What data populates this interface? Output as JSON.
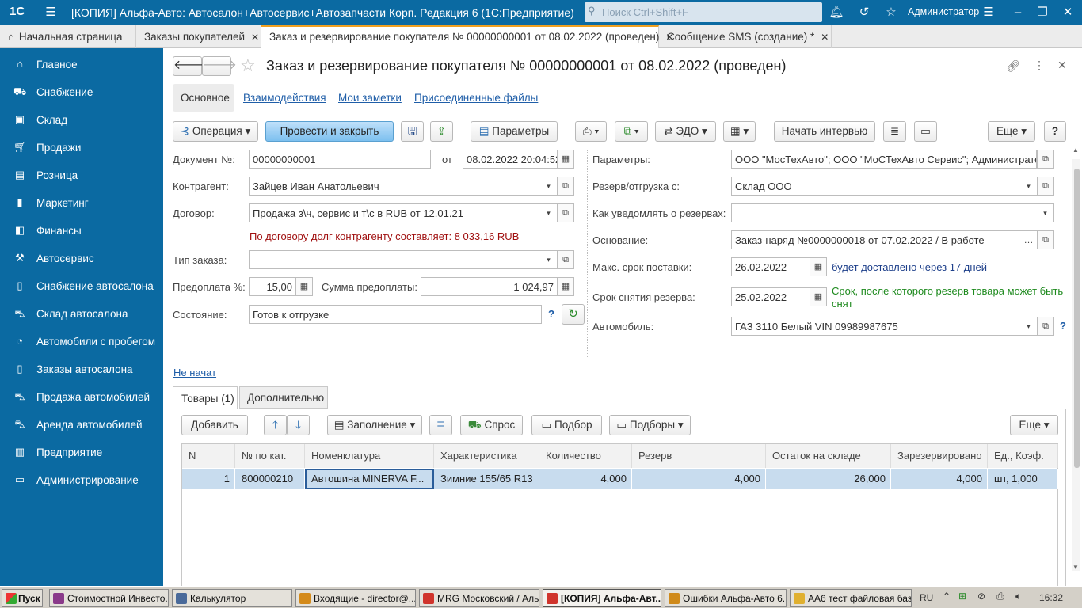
{
  "window": {
    "logo": "1С",
    "title": "[КОПИЯ] Альфа-Авто: Автосалон+Автосервис+Автозапчасти Корп. Редакция 6  (1С:Предприятие)",
    "search_placeholder": "Поиск Ctrl+Shift+F",
    "user": "Администратор"
  },
  "tabs": [
    {
      "label": "Начальная страница"
    },
    {
      "label": "Заказы покупателей"
    },
    {
      "label": "Заказ и резервирование покупателя № 00000000001 от 08.02.2022 (проведен)"
    },
    {
      "label": "Сообщение SMS (создание) *"
    }
  ],
  "sidebar": [
    {
      "label": "Главное",
      "icon": "home-icon"
    },
    {
      "label": "Снабжение",
      "icon": "truck-icon"
    },
    {
      "label": "Склад",
      "icon": "warehouse-icon"
    },
    {
      "label": "Продажи",
      "icon": "cart-icon"
    },
    {
      "label": "Розница",
      "icon": "store-icon"
    },
    {
      "label": "Маркетинг",
      "icon": "chart-icon"
    },
    {
      "label": "Финансы",
      "icon": "finance-icon"
    },
    {
      "label": "Автосервис",
      "icon": "wrench-icon"
    },
    {
      "label": "Снабжение автосалона",
      "icon": "doc-icon"
    },
    {
      "label": "Склад автосалона",
      "icon": "car-icon"
    },
    {
      "label": "Автомобили с пробегом",
      "icon": "speedometer-icon"
    },
    {
      "label": "Заказы автосалона",
      "icon": "doc-icon"
    },
    {
      "label": "Продажа автомобилей",
      "icon": "car-icon"
    },
    {
      "label": "Аренда автомобилей",
      "icon": "car-icon"
    },
    {
      "label": "Предприятие",
      "icon": "building-icon"
    },
    {
      "label": "Администрирование",
      "icon": "monitor-icon"
    }
  ],
  "doc": {
    "title": "Заказ и резервирование покупателя № 00000000001 от 08.02.2022 (проведен)",
    "subtabs": [
      "Основное",
      "Взаимодействия",
      "Мои заметки",
      "Присоединенные файлы"
    ],
    "toolbar": {
      "operation": "Операция",
      "post_close": "Провести и закрыть",
      "params": "Параметры",
      "edo": "ЭДО",
      "interview": "Начать интервью",
      "more": "Еще",
      "help": "?"
    },
    "fields": {
      "doc_no_label": "Документ №:",
      "doc_no": "00000000001",
      "from_label": "от",
      "date": "08.02.2022 20:04:52",
      "contractor_label": "Контрагент:",
      "contractor": "Зайцев Иван Анатольевич",
      "contract_label": "Договор:",
      "contract": "Продажа з\\ч, сервис и т\\с в RUB от 12.01.21",
      "debt_link": "По договору долг контрагенту составляет: 8 033,16 RUB",
      "order_type_label": "Тип заказа:",
      "order_type": "",
      "prepay_pct_label": "Предоплата %:",
      "prepay_pct": "15,00",
      "prepay_sum_label": "Сумма предоплаты:",
      "prepay_sum": "1 024,97",
      "state_label": "Состояние:",
      "state": "Готов к отгрузке",
      "state_help": "?",
      "params_label": "Параметры:",
      "params": "ООО \"МосТехАвто\"; ООО \"МоСТехАвто Сервис\"; Администратор",
      "reserve_from_label": "Резерв/отгрузка с:",
      "reserve_from": "Склад ООО",
      "notify_label": "Как уведомлять о резервах:",
      "notify": "",
      "basis_label": "Основание:",
      "basis": "Заказ-наряд №0000000018  от 07.02.2022 / В работе",
      "max_delivery_label": "Макс. срок поставки:",
      "max_delivery": "26.02.2022",
      "delivery_note": "будет доставлено через 17 дней",
      "reserve_removal_label": "Срок снятия резерва:",
      "reserve_removal": "25.02.2022",
      "reserve_note": "Срок, после которого резерв товара может быть снят",
      "car_label": "Автомобиль:",
      "car": "ГАЗ 3110 Белый VIN 09989987675",
      "car_help": "?",
      "status_link": "Не начат"
    },
    "item_tabs": [
      "Товары (1)",
      "Дополнительно"
    ],
    "item_toolbar": {
      "add": "Добавить",
      "fill": "Заполнение",
      "demand": "Спрос",
      "pick": "Подбор",
      "picks": "Подборы",
      "more": "Еще"
    },
    "columns": [
      "N",
      "№ по кат.",
      "Номенклатура",
      "Характеристика",
      "Количество",
      "Резерв",
      "Остаток на складе",
      "Зарезервировано",
      "Ед., Коэф."
    ],
    "rows": [
      [
        "1",
        "800000210",
        "Автошина MINERVA F...",
        "Зимние 155/65 R13",
        "4,000",
        "4,000",
        "26,000",
        "4,000",
        "шт, 1,000"
      ]
    ]
  },
  "taskbar": {
    "start": "Пуск",
    "items": [
      "Стоимостной Инвесто...",
      "Калькулятор",
      "Входящие - director@...",
      "MRG Московский / Аль...",
      "[КОПИЯ] Альфа-Авт...",
      "Ошибки Альфа-Авто 6...",
      "АА6 тест файловая база"
    ],
    "lang": "RU",
    "time": "16:32"
  }
}
